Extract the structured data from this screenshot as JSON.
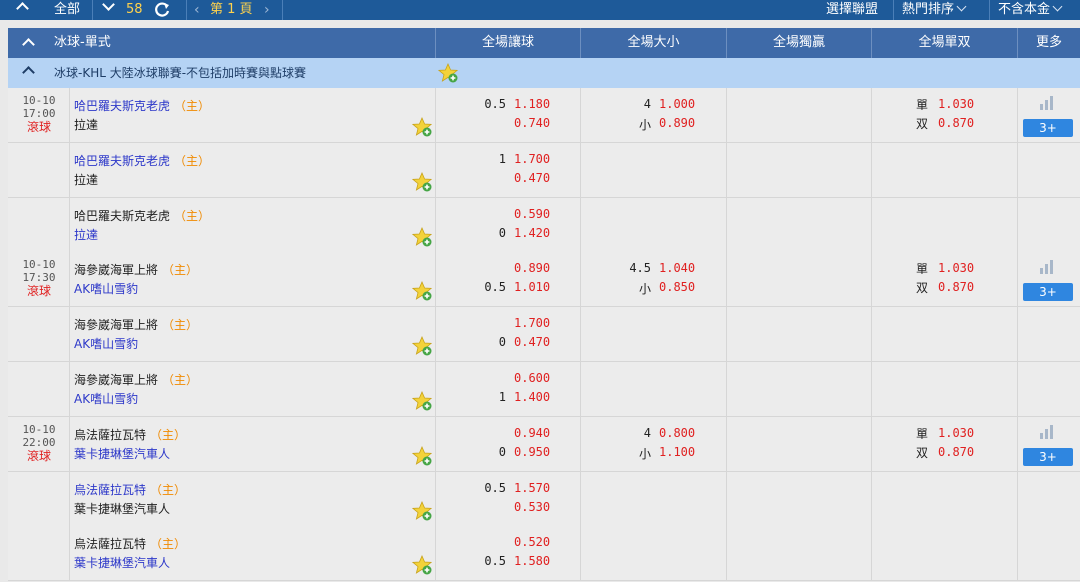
{
  "toolbar": {
    "all_label": "全部",
    "count": "58",
    "page_label": "第 1 頁",
    "select_league": "選擇聯盟",
    "hot_sort": "熱門排序",
    "no_principal": "不含本金"
  },
  "header": {
    "sport": "冰球-單式",
    "handicap": "全場讓球",
    "over_under": "全場大小",
    "moneyline": "全場獨贏",
    "odd_even": "全場單双",
    "more": "更多"
  },
  "league": {
    "name": "冰球-KHL  大陸冰球聯賽-不包括加時賽與點球賽"
  },
  "labels": {
    "home_tag": "（主）",
    "small": "小",
    "odd": "單",
    "even": "双",
    "more_btn": "3+"
  },
  "colors": {
    "toolbar": "#1e5a99",
    "header": "#3e6aa8",
    "league": "#b5d3f4",
    "price": "#e02020",
    "team_blue": "#2d38c9",
    "home_tag": "#f08a00",
    "more_btn": "#2f86e0"
  },
  "matches": [
    {
      "date": "10-10",
      "time": "17:00",
      "status": "滾球",
      "rows": [
        {
          "home": "哈巴羅夫斯克老虎",
          "away": "拉達",
          "home_tag": true,
          "color_home": "blue",
          "color_away": "black",
          "hcp1_line": "0.5",
          "hcp1": "1.180",
          "hcp2_line": "",
          "hcp2": "0.740",
          "ou1_line": "4",
          "ou1": "1.000",
          "ou2": "0.890",
          "odd": "1.030",
          "even": "0.870",
          "more": true
        },
        {
          "home": "哈巴羅夫斯克老虎",
          "away": "拉達",
          "home_tag": true,
          "color_home": "blue",
          "color_away": "black",
          "hcp1_line": "1",
          "hcp1": "1.700",
          "hcp2_line": "",
          "hcp2": "0.470"
        },
        {
          "home": "哈巴羅夫斯克老虎",
          "away": "拉達",
          "home_tag": true,
          "color_home": "black",
          "color_away": "blue",
          "hcp1_line": "",
          "hcp1": "0.590",
          "hcp2_line": "0",
          "hcp2": "1.420"
        }
      ]
    },
    {
      "date": "10-10",
      "time": "17:30",
      "status": "滾球",
      "rows": [
        {
          "home": "海參崴海軍上將",
          "away": "AK嗜山雪豹",
          "home_tag": true,
          "color_home": "black",
          "color_away": "blue",
          "hcp1_line": "",
          "hcp1": "0.890",
          "hcp2_line": "0.5",
          "hcp2": "1.010",
          "ou1_line": "4.5",
          "ou1": "1.040",
          "ou2": "0.850",
          "odd": "1.030",
          "even": "0.870",
          "more": true
        },
        {
          "home": "海參崴海軍上將",
          "away": "AK嗜山雪豹",
          "home_tag": true,
          "color_home": "black",
          "color_away": "blue",
          "hcp1_line": "",
          "hcp1": "1.700",
          "hcp2_line": "0",
          "hcp2": "0.470"
        },
        {
          "home": "海參崴海軍上將",
          "away": "AK嗜山雪豹",
          "home_tag": true,
          "color_home": "black",
          "color_away": "blue",
          "hcp1_line": "",
          "hcp1": "0.600",
          "hcp2_line": "1",
          "hcp2": "1.400"
        }
      ]
    },
    {
      "date": "10-10",
      "time": "22:00",
      "status": "滾球",
      "rows": [
        {
          "home": "烏法薩拉瓦特",
          "away": "葉卡捷琳堡汽車人",
          "home_tag": true,
          "color_home": "black",
          "color_away": "blue",
          "hcp1_line": "",
          "hcp1": "0.940",
          "hcp2_line": "0",
          "hcp2": "0.950",
          "ou1_line": "4",
          "ou1": "0.800",
          "ou2": "1.100",
          "odd": "1.030",
          "even": "0.870",
          "more": true
        },
        {
          "home": "烏法薩拉瓦特",
          "away": "葉卡捷琳堡汽車人",
          "home_tag": true,
          "color_home": "blue",
          "color_away": "black",
          "hcp1_line": "0.5",
          "hcp1": "1.570",
          "hcp2_line": "",
          "hcp2": "0.530"
        },
        {
          "home": "烏法薩拉瓦特",
          "away": "葉卡捷琳堡汽車人",
          "home_tag": true,
          "color_home": "black",
          "color_away": "blue",
          "hcp1_line": "",
          "hcp1": "0.520",
          "hcp2_line": "0.5",
          "hcp2": "1.580"
        }
      ]
    }
  ]
}
